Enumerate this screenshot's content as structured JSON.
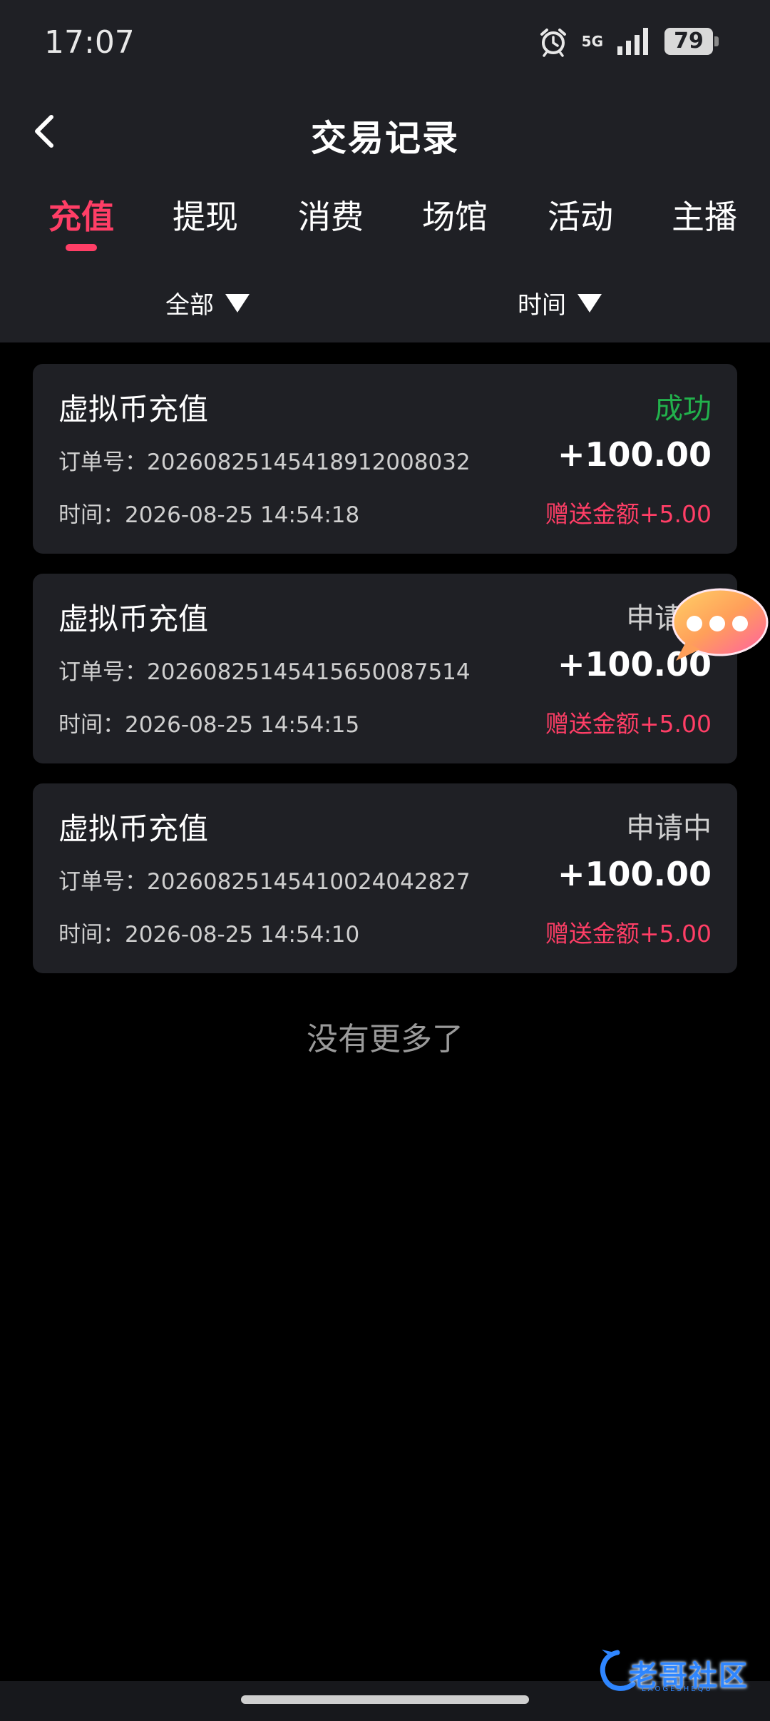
{
  "status_bar": {
    "time": "17:07",
    "network": "5G",
    "battery": "79"
  },
  "header": {
    "title": "交易记录"
  },
  "tabs": [
    {
      "label": "充值"
    },
    {
      "label": "提现"
    },
    {
      "label": "消费"
    },
    {
      "label": "场馆"
    },
    {
      "label": "活动"
    },
    {
      "label": "主播"
    }
  ],
  "filters": {
    "category": "全部",
    "time": "时间"
  },
  "records": [
    {
      "type": "虚拟币充值",
      "status": "成功",
      "status_color": "#22b14c",
      "order_label": "订单号：",
      "order_no": "20260825145418912008032",
      "amount": "+100.00",
      "time_label": "时间：",
      "time": "2026-08-25 14:54:18",
      "bonus": "赠送金额+5.00"
    },
    {
      "type": "虚拟币充值",
      "status": "申请中",
      "status_color": "#cfcfcf",
      "order_label": "订单号：",
      "order_no": "20260825145415650087514",
      "amount": "+100.00",
      "time_label": "时间：",
      "time": "2026-08-25 14:54:15",
      "bonus": "赠送金额+5.00"
    },
    {
      "type": "虚拟币充值",
      "status": "申请中",
      "status_color": "#cfcfcf",
      "order_label": "订单号：",
      "order_no": "20260825145410024042827",
      "amount": "+100.00",
      "time_label": "时间：",
      "time": "2026-08-25 14:54:10",
      "bonus": "赠送金额+5.00"
    }
  ],
  "footer": {
    "no_more": "没有更多了"
  },
  "watermark": {
    "text": "老哥社区",
    "sub": "LAOGESHEQU"
  },
  "colors": {
    "accent": "#ff3e66",
    "success": "#22b14c",
    "panel": "#1f2025"
  }
}
